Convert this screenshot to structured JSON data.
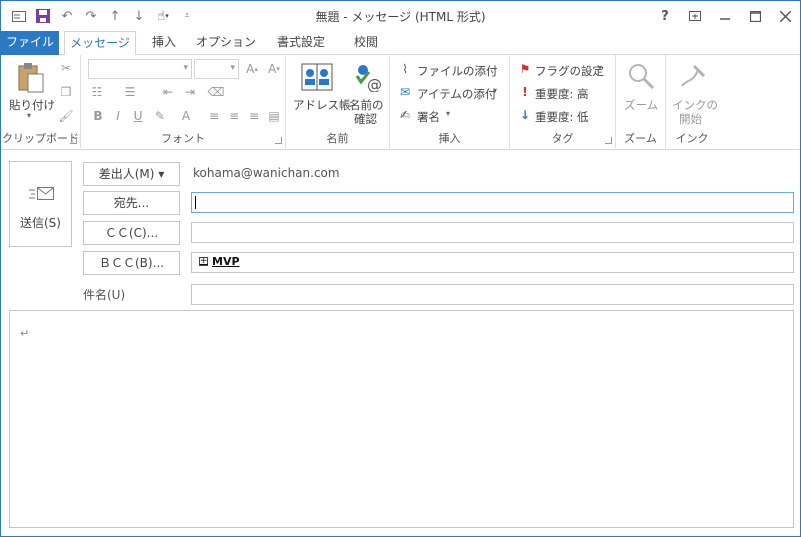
{
  "title": "無題 - メッセージ (HTML 形式)",
  "window_controls": {
    "help": "?",
    "ribbon_display": "restore-ribbon-icon",
    "minimize": "minimize-icon",
    "maximize": "maximize-icon",
    "close": "close-icon"
  },
  "quick_access": [
    "mail-icon",
    "save-icon",
    "undo-icon",
    "redo-icon",
    "up-arrow-icon",
    "down-arrow-icon",
    "touch-mode-icon",
    "customize-icon"
  ],
  "tabs": [
    {
      "label": "ファイル",
      "active": false
    },
    {
      "label": "メッセージ",
      "active": true
    },
    {
      "label": "挿入",
      "active": false
    },
    {
      "label": "オプション",
      "active": false
    },
    {
      "label": "書式設定",
      "active": false
    },
    {
      "label": "校閲",
      "active": false
    }
  ],
  "ribbon": {
    "clipboard": {
      "label": "クリップボード",
      "paste": "貼り付け"
    },
    "font": {
      "label": "フォント"
    },
    "names": {
      "label": "名前",
      "address_book": "アドレス帳",
      "check_names_1": "名前の",
      "check_names_2": "確認"
    },
    "insert": {
      "label": "挿入",
      "attach_file": "ファイルの添付",
      "attach_item": "アイテムの添付",
      "signature": "署名"
    },
    "tags": {
      "label": "タグ",
      "flag": "フラグの設定",
      "high": "重要度: 高",
      "low": "重要度: 低"
    },
    "zoom": {
      "label": "ズーム",
      "zoom": "ズーム"
    },
    "ink": {
      "label": "インク",
      "start_1": "インクの",
      "start_2": "開始"
    }
  },
  "send": {
    "label": "送信(S)"
  },
  "fields": {
    "from_button": "差出人(M) ▾",
    "from_value": "kohama@wanichan.com",
    "to_button": "宛先...",
    "cc_button": "ＣＣ(C)...",
    "bcc_button": "ＢＣＣ(B)...",
    "bcc_value": "MVP",
    "subject_label": "件名(U)",
    "subject_value": ""
  },
  "body": {
    "paragraph_mark": "↵"
  },
  "colors": {
    "accent": "#2b79c4",
    "flag": "#d0312d",
    "importance_high": "#d0312d",
    "importance_low": "#2b79c4"
  }
}
